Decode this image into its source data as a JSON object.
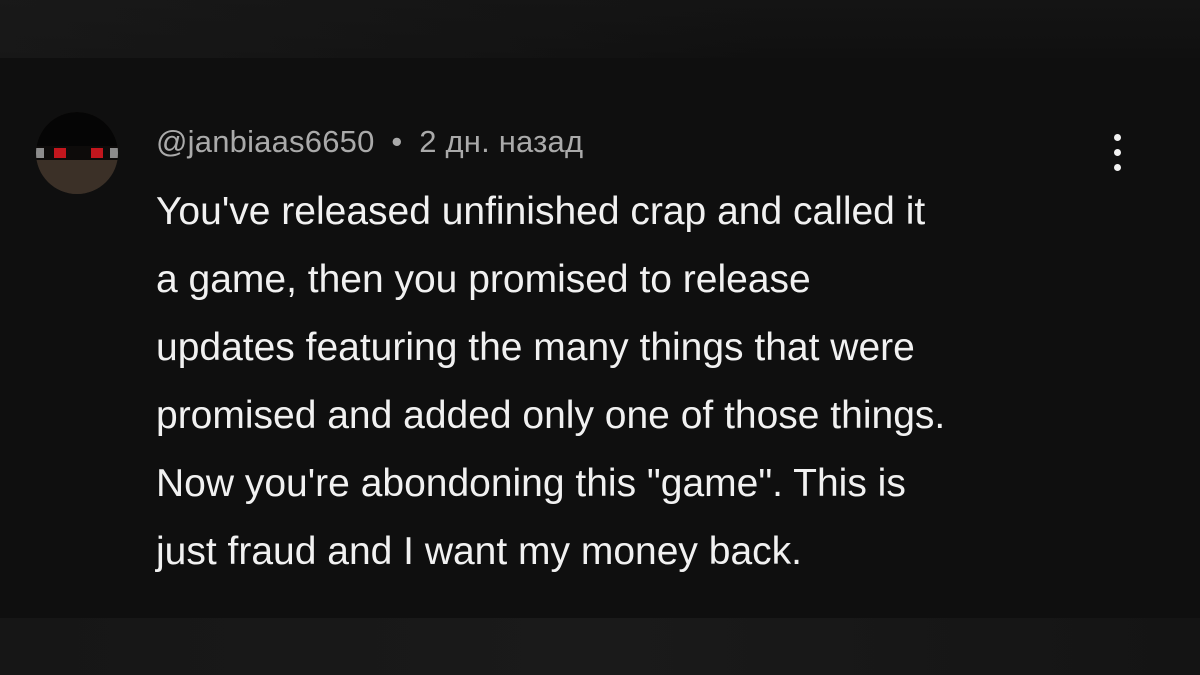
{
  "comment": {
    "author": "@janbiaas6650",
    "separator": "•",
    "time": "2 дн. назад",
    "text": "You've released unfinished crap and called it\na game, then you promised to release\nupdates featuring the many things that were\npromised and added only one of those things.\nNow you're abondoning this \"game\". This is\njust fraud and I want my money back.",
    "avatar_icon": "pixel-avatar-icon",
    "menu_icon": "more-vertical-icon"
  },
  "colors": {
    "background": "#0f0f0f",
    "text_primary": "#f1f1f1",
    "text_secondary": "#aaaaaa",
    "avatar_eye": "#c2161d"
  }
}
